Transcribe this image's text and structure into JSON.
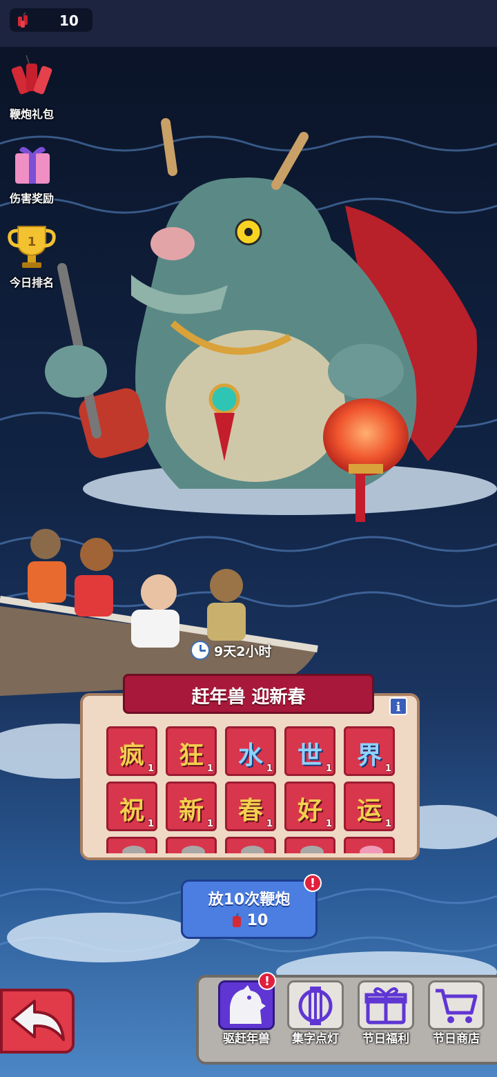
{
  "top_bar": {
    "firecracker_count": "10",
    "firecracker_icon": "firecracker-icon"
  },
  "side_menu": [
    {
      "label": "鞭炮礼包",
      "icon": "firecracker-bundle-icon"
    },
    {
      "label": "伤害奖励",
      "icon": "gift-box-icon"
    },
    {
      "label": "今日排名",
      "icon": "trophy-icon"
    }
  ],
  "event": {
    "timer": "9天2小时",
    "title": "赶年兽 迎新春",
    "info_label": "i",
    "tiles_row1": [
      {
        "char": "疯",
        "count": "1"
      },
      {
        "char": "狂",
        "count": "1"
      },
      {
        "char": "水",
        "count": "1"
      },
      {
        "char": "世",
        "count": "1"
      },
      {
        "char": "界",
        "count": "1"
      }
    ],
    "tiles_row2": [
      {
        "char": "祝",
        "count": "1"
      },
      {
        "char": "新",
        "count": "1"
      },
      {
        "char": "春",
        "count": "1"
      },
      {
        "char": "好",
        "count": "1"
      },
      {
        "char": "运",
        "count": "1"
      }
    ]
  },
  "fire_button": {
    "label": "放10次鞭炮",
    "cost": "10",
    "badge": "!"
  },
  "bottom_nav": [
    {
      "label": "驱赶年兽",
      "icon": "monster-silhouette-icon",
      "active": true,
      "badge": "!"
    },
    {
      "label": "集字点灯",
      "icon": "lantern-icon",
      "active": false
    },
    {
      "label": "节日福利",
      "icon": "gift-icon",
      "active": false
    },
    {
      "label": "节日商店",
      "icon": "cart-icon",
      "active": false
    }
  ],
  "colors": {
    "event_banner": "#a8183a",
    "tile": "#d8364c",
    "fire_button": "#4b7ee0",
    "back_button": "#e13a49",
    "active_nav": "#5f36d3"
  }
}
